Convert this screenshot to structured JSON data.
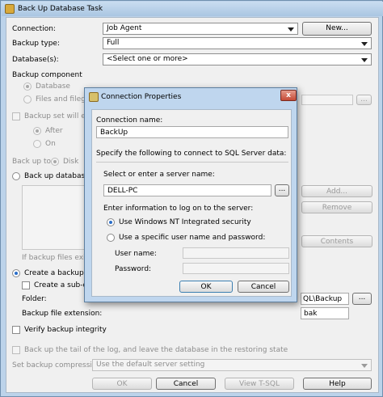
{
  "window": {
    "title": "Back Up Database Task"
  },
  "form": {
    "connection_label": "Connection:",
    "connection_value": "Job Agent",
    "new_button": "New...",
    "backup_type_label": "Backup type:",
    "backup_type_value": "Full",
    "databases_label": "Database(s):",
    "databases_value": "<Select one or more>",
    "backup_component_label": "Backup component",
    "component_database": "Database",
    "component_files": "Files and filegro",
    "ellipsis": "...",
    "backup_set_expire": "Backup set will expi",
    "after_label": "After",
    "on_label": "On",
    "back_up_to_label": "Back up to:",
    "disk_label": "Disk",
    "back_up_across": "Back up databases a",
    "add_button": "Add...",
    "remove_button": "Remove",
    "contents_button": "Contents",
    "if_backup_files_exist": "If backup files exist:",
    "create_backup_file": "Create a backup file",
    "create_subdir": "Create a sub-dire",
    "folder_label": "Folder:",
    "folder_value": "QL\\Backup",
    "extension_label": "Backup file extension:",
    "extension_value": "bak",
    "verify_integrity": "Verify backup integrity",
    "tail_log": "Back up the tail of the log, and leave the database in the restoring state",
    "compression_label": "Set backup compression:",
    "compression_value": "Use the default server setting"
  },
  "footer": {
    "ok": "OK",
    "cancel": "Cancel",
    "view_tsql": "View T-SQL",
    "help": "Help"
  },
  "dialog": {
    "title": "Connection Properties",
    "close_glyph": "x",
    "connection_name_label": "Connection name:",
    "connection_name_value": "BackUp",
    "specify_text": "Specify the following to connect to SQL Server data:",
    "server_label": "Select or enter a server name:",
    "server_value": "DELL-PC",
    "ellipsis": "...",
    "logon_label": "Enter information to log on to the server:",
    "windows_auth": "Use Windows NT Integrated security",
    "sql_auth": "Use a specific user name and password:",
    "username_label": "User name:",
    "username_value": "",
    "password_label": "Password:",
    "password_value": "",
    "ok": "OK",
    "cancel": "Cancel"
  }
}
